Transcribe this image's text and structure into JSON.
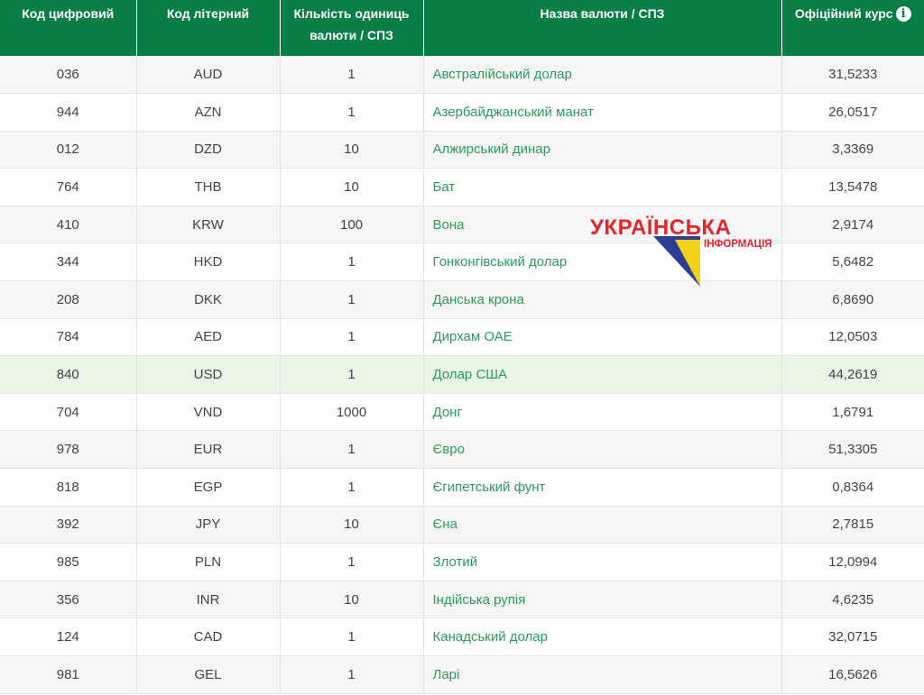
{
  "table": {
    "headers": {
      "code_numeric": "Код цифровий",
      "code_letter": "Код літерний",
      "units": "Кількість одиниць валюти / СПЗ",
      "name": "Назва валюти / СПЗ",
      "rate": "Офіційний курс"
    },
    "rows": [
      {
        "code": "036",
        "letter": "AUD",
        "units": "1",
        "name": "Австралійський долар",
        "rate": "31,5233"
      },
      {
        "code": "944",
        "letter": "AZN",
        "units": "1",
        "name": "Азербайджанський манат",
        "rate": "26,0517"
      },
      {
        "code": "012",
        "letter": "DZD",
        "units": "10",
        "name": "Алжирський динар",
        "rate": "3,3369"
      },
      {
        "code": "764",
        "letter": "THB",
        "units": "10",
        "name": "Бат",
        "rate": "13,5478"
      },
      {
        "code": "410",
        "letter": "KRW",
        "units": "100",
        "name": "Вона",
        "rate": "2,9174"
      },
      {
        "code": "344",
        "letter": "HKD",
        "units": "1",
        "name": "Гонконгівський долар",
        "rate": "5,6482"
      },
      {
        "code": "208",
        "letter": "DKK",
        "units": "1",
        "name": "Данська крона",
        "rate": "6,8690"
      },
      {
        "code": "784",
        "letter": "AED",
        "units": "1",
        "name": "Дирхам ОАЕ",
        "rate": "12,0503"
      },
      {
        "code": "840",
        "letter": "USD",
        "units": "1",
        "name": "Долар США",
        "rate": "44,2619"
      },
      {
        "code": "704",
        "letter": "VND",
        "units": "1000",
        "name": "Донг",
        "rate": "1,6791"
      },
      {
        "code": "978",
        "letter": "EUR",
        "units": "1",
        "name": "Євро",
        "rate": "51,3305"
      },
      {
        "code": "818",
        "letter": "EGP",
        "units": "1",
        "name": "Єгипетський фунт",
        "rate": "0,8364"
      },
      {
        "code": "392",
        "letter": "JPY",
        "units": "10",
        "name": "Єна",
        "rate": "2,7815"
      },
      {
        "code": "985",
        "letter": "PLN",
        "units": "1",
        "name": "Злотий",
        "rate": "12,0994"
      },
      {
        "code": "356",
        "letter": "INR",
        "units": "10",
        "name": "Індійська рупія",
        "rate": "4,6235"
      },
      {
        "code": "124",
        "letter": "CAD",
        "units": "1",
        "name": "Канадський долар",
        "rate": "32,0715"
      },
      {
        "code": "981",
        "letter": "GEL",
        "units": "1",
        "name": "Ларі",
        "rate": "16,5626"
      }
    ]
  },
  "watermark": {
    "line1": "УКРАЇНСЬКА",
    "line2": "ІНФОРМАЦІЯ"
  },
  "colors": {
    "header_bg": "#077e45",
    "link": "#2c9a5c",
    "highlight_row": "#e9f6e5",
    "watermark_red": "#e3262d",
    "watermark_blue": "#2c3e92",
    "watermark_yellow": "#f3d21a"
  },
  "icons": {
    "rate_info": "info-icon"
  }
}
